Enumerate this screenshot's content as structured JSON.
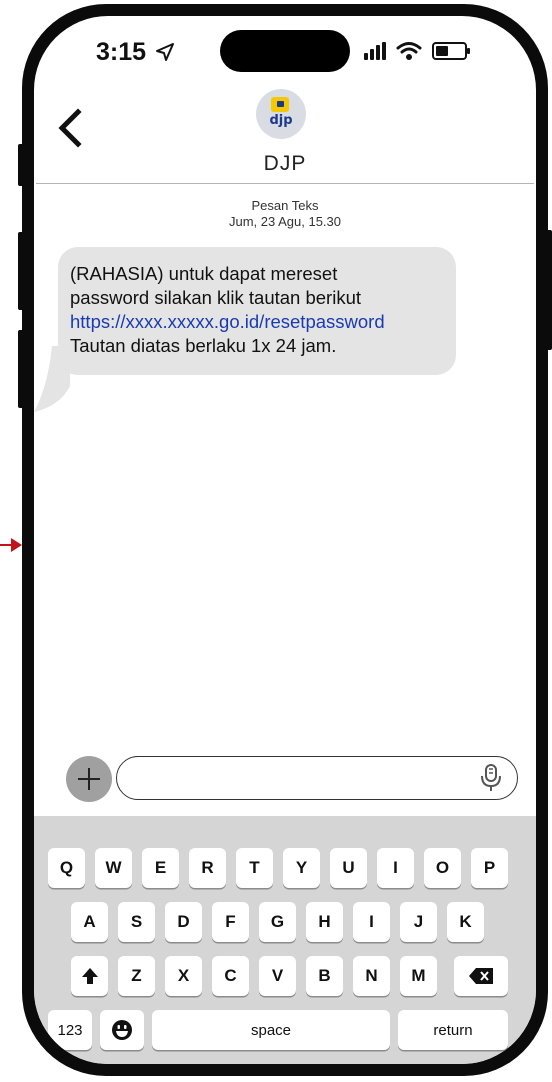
{
  "status_bar": {
    "time": "3:15"
  },
  "header": {
    "contact_name": "DJP",
    "avatar_text": "djp"
  },
  "thread": {
    "meta_label": "Pesan Teks",
    "meta_date": "Jum, 23 Agu, 15.30",
    "message": {
      "line1": "(RAHASIA) untuk dapat mereset",
      "line2": "password silakan klik tautan berikut",
      "link": "https://xxxx.xxxxx.go.id/resetpassword",
      "line4": "Tautan diatas berlaku 1x 24 jam."
    }
  },
  "composer": {
    "placeholder": ""
  },
  "keyboard": {
    "row1": [
      "Q",
      "W",
      "E",
      "R",
      "T",
      "Y",
      "U",
      "I",
      "O",
      "P"
    ],
    "row2": [
      "A",
      "S",
      "D",
      "F",
      "G",
      "H",
      "I",
      "J",
      "K"
    ],
    "row3": [
      "Z",
      "X",
      "C",
      "V",
      "B",
      "N",
      "M"
    ],
    "numbers_label": "123",
    "space_label": "space",
    "return_label": "return"
  },
  "colors": {
    "link": "#1a3bb0",
    "bubble": "#e4e4e4",
    "arrow": "#c0141b",
    "keyboard_bg": "#d5d5d5"
  }
}
